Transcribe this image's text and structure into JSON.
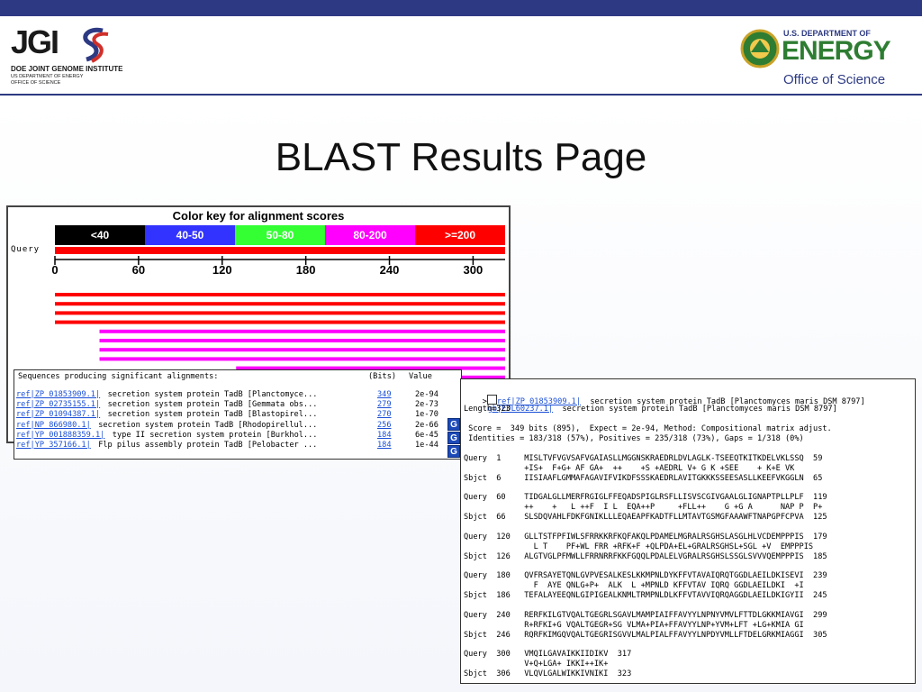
{
  "colors": {
    "topbar": "#2d3a83",
    "red": "#ff0000",
    "magenta": "#ff00ff",
    "green": "#33ff33",
    "blue": "#3333ff",
    "black": "#000000",
    "link": "#1a4fd6"
  },
  "header": {
    "jgi": {
      "letters": "JGI",
      "line1": "DOE JOINT GENOME INSTITUTE",
      "line2": "US DEPARTMENT OF ENERGY",
      "line3": "OFFICE OF SCIENCE"
    },
    "doe": {
      "line1": "U.S. DEPARTMENT OF",
      "line2": "ENERGY",
      "line3": "Office of Science"
    }
  },
  "title": "BLAST Results Page",
  "graphic": {
    "key_title": "Color key for alignment scores",
    "key": [
      {
        "label": "<40",
        "color": "#000000"
      },
      {
        "label": "40-50",
        "color": "#3333ff"
      },
      {
        "label": "50-80",
        "color": "#33ff33"
      },
      {
        "label": "80-200",
        "color": "#ff00ff"
      },
      {
        "label": ">=200",
        "color": "#ff0000"
      }
    ],
    "query_label": "Query",
    "query_length": 323,
    "ticks": [
      "0",
      "60",
      "120",
      "180",
      "240",
      "300"
    ],
    "hits": [
      {
        "start": 0,
        "end": 323,
        "color": "red"
      },
      {
        "start": 0,
        "end": 323,
        "color": "red"
      },
      {
        "start": 0,
        "end": 323,
        "color": "red"
      },
      {
        "start": 0,
        "end": 323,
        "color": "red"
      },
      {
        "start": 32,
        "end": 323,
        "color": "magenta"
      },
      {
        "start": 32,
        "end": 323,
        "color": "magenta"
      },
      {
        "start": 32,
        "end": 323,
        "color": "magenta"
      },
      {
        "start": 32,
        "end": 323,
        "color": "magenta"
      },
      {
        "start": 130,
        "end": 323,
        "color": "magenta"
      },
      {
        "start": 130,
        "end": 323,
        "color": "magenta"
      },
      {
        "start": 200,
        "end": 323,
        "color": "magenta"
      }
    ]
  },
  "panel1": {
    "header": "Sequences producing significant alignments:",
    "bits_header": "(Bits)",
    "value_header": "Value",
    "rows": [
      {
        "id": "ref|ZP_01853909.1|",
        "desc": "secretion system protein TadB [Planctomyce...",
        "score": "349",
        "evalue": "2e-94"
      },
      {
        "id": "ref|ZP_02735155.1|",
        "desc": "secretion system protein TadB [Gemmata obs...",
        "score": "279",
        "evalue": "2e-73"
      },
      {
        "id": "ref|ZP_01094387.1|",
        "desc": "secretion system protein TadB [Blastopirel...",
        "score": "270",
        "evalue": "1e-70"
      },
      {
        "id": "ref|NP_866980.1|",
        "desc": "secretion system protein TadB [Rhodopirellul...",
        "score": "256",
        "evalue": "2e-66"
      },
      {
        "id": "ref|YP_001888359.1|",
        "desc": "type II secretion system protein [Burkhol...",
        "score": "184",
        "evalue": "6e-45"
      },
      {
        "id": "ref|YP_357166.1|",
        "desc": "Flp pilus assembly protein TadB [Pelobacter ...",
        "score": "184",
        "evalue": "1e-44"
      }
    ],
    "g_icon": "G"
  },
  "panel2": {
    "gt": ">",
    "ref_id": "ref|ZP_01853909.1|",
    "ref_desc": "  secretion system protein TadB [Planctomyces maris DSM 8797]",
    "gb_id": "gb|EDL60237.1|",
    "gb_desc": "  secretion system protein TadB [Planctomyces maris DSM 8797]",
    "length": "Length=323",
    "score_line": " Score =  349 bits (895),  Expect = 2e-94, Method: Compositional matrix adjust.",
    "ident_line": " Identities = 183/318 (57%), Positives = 235/318 (73%), Gaps = 1/318 (0%)",
    "blocks": [
      {
        "q": "Query  1     MISLTVFVGVSAFVGAIASLLMGGNSKRAEDRLDVLAGLK-TSEEQTKITKDELVKLSSQ  59",
        "m": "             +IS+  F+G+ AF GA+  ++    +S +AEDRL V+ G K +SEE    + K+E VK",
        "s": "Sbjct  6     IISIAAFLGMMAFAGAVIFVIKDFSSSKAEDRLAVITGKKKSSEESASLLKEEFVKGGLN  65"
      },
      {
        "q": "Query  60    TIDGALGLLMERFRGIGLFFEQADSPIGLRSFLLISVSCGIVGAALGLIGNAPTPLLPLF  119",
        "m": "             ++    +   L ++F  I L  EQA++P     +FLL++    G +G A      NAP P  P+",
        "s": "Sbjct  66    SLSDQVAHLFDKFGNIKLLLEQAEAPFKADTFLLMTAVTGSMGFAAAWFTNAPGPFCPVA  125"
      },
      {
        "q": "Query  120   GLLTSTFPFIWLSFRRKKRFKQFAKQLPDAMELMGRALRSGHSLASGLHLVCDEMPPPIS  179",
        "m": "               L T    PF+WL FRR +RFK+F +QLPDA+EL+GRALRSGHSL+SGL +V  EMPPPIS",
        "s": "Sbjct  126   ALGTVGLPFMWLLFRRNRRFKKFGQQLPDALELVGRALRSGHSLSSGLSVVVQEMPPPIS  185"
      },
      {
        "q": "Query  180   QVFRSAYETQNLGVPVESALKESLKKMPNLDYKFFVTAVAIQRQTGGDLAEILDKISEVI  239",
        "m": "               F  AYE QNLG+P+  ALK  L +MPNLD KFFVTAV IQRQ GGDLAEILDKI  +I",
        "s": "Sbjct  186   TEFALAYEEQNLGIPIGEALKNMLTRMPNLDLKFFVTAVVIQRQAGGDLAEILDKIGYII  245"
      },
      {
        "q": "Query  240   RERFKILGTVQALTGEGRLSGAVLMAMPIAIFFAVYYLNPNYVMVLFTTDLGKKMIAVGI  299",
        "m": "             R+RFKI+G VQALTGEGR+SG VLMA+PIA+FFAVYYLNP+YVM+LFT +LG+KMIA GI",
        "s": "Sbjct  246   RQRFKIMGQVQALTGEGRISGVVLMALPIALFFAVYYLNPDYVMLLFTDELGRKMIAGGI  305"
      },
      {
        "q": "Query  300   VMQILGAVAIKKIIDIKV  317",
        "m": "             V+Q+LGA+ IKKI++IK+",
        "s": "Sbjct  306   VLQVLGALWIKKIVNIKI  323"
      }
    ]
  }
}
